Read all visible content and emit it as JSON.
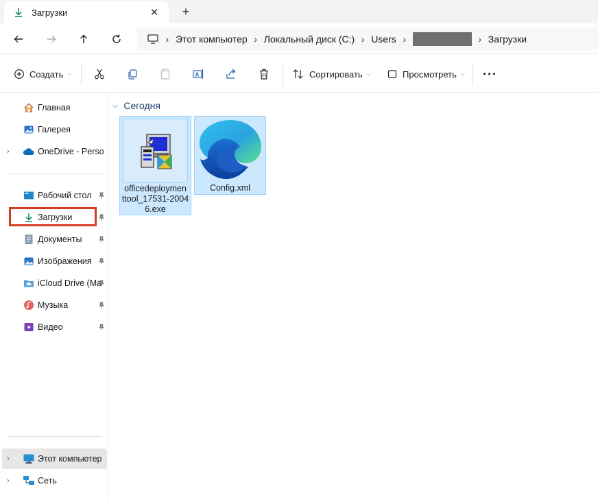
{
  "tab": {
    "title": "Загрузки",
    "new_tab_symbol": "+",
    "close_symbol": "✕"
  },
  "address": {
    "crumbs": [
      "Этот компьютер",
      "Локальный диск (C:)",
      "Users",
      "",
      "Загрузки"
    ]
  },
  "toolbar": {
    "create_label": "Создать",
    "sort_label": "Сортировать",
    "view_label": "Просмотреть",
    "more_label": "···"
  },
  "sidebar": {
    "top_items": [
      {
        "label": "Главная",
        "icon": "home-icon"
      },
      {
        "label": "Галерея",
        "icon": "gallery-icon"
      },
      {
        "label": "OneDrive - Persona",
        "icon": "cloud-icon"
      }
    ],
    "pinned_items": [
      {
        "label": "Рабочий стол",
        "icon": "desktop-icon"
      },
      {
        "label": "Загрузки",
        "icon": "download-icon"
      },
      {
        "label": "Документы",
        "icon": "document-icon"
      },
      {
        "label": "Изображения",
        "icon": "image-icon"
      },
      {
        "label": "iCloud Drive (Ma",
        "icon": "icloud-folder-icon"
      },
      {
        "label": "Музыка",
        "icon": "music-icon"
      },
      {
        "label": "Видео",
        "icon": "video-icon"
      }
    ],
    "bottom_items": [
      {
        "label": "Этот компьютер",
        "icon": "computer-icon"
      },
      {
        "label": "Сеть",
        "icon": "network-icon"
      }
    ]
  },
  "content": {
    "group_label": "Сегодня",
    "files": [
      {
        "name": "officedeploymenttool_17531-20046.exe",
        "name_lines": [
          "officedeploymen",
          "ttool_17531-2004",
          "6.exe"
        ],
        "icon": "installer-icon"
      },
      {
        "name": "Config.xml",
        "name_lines": [
          "Config.xml"
        ],
        "icon": "edge-icon"
      }
    ]
  },
  "colors": {
    "accent": "#0f7b6c",
    "selection": "#cce8ff",
    "highlight_box": "#d33a22",
    "group_text": "#1b3e6e"
  }
}
